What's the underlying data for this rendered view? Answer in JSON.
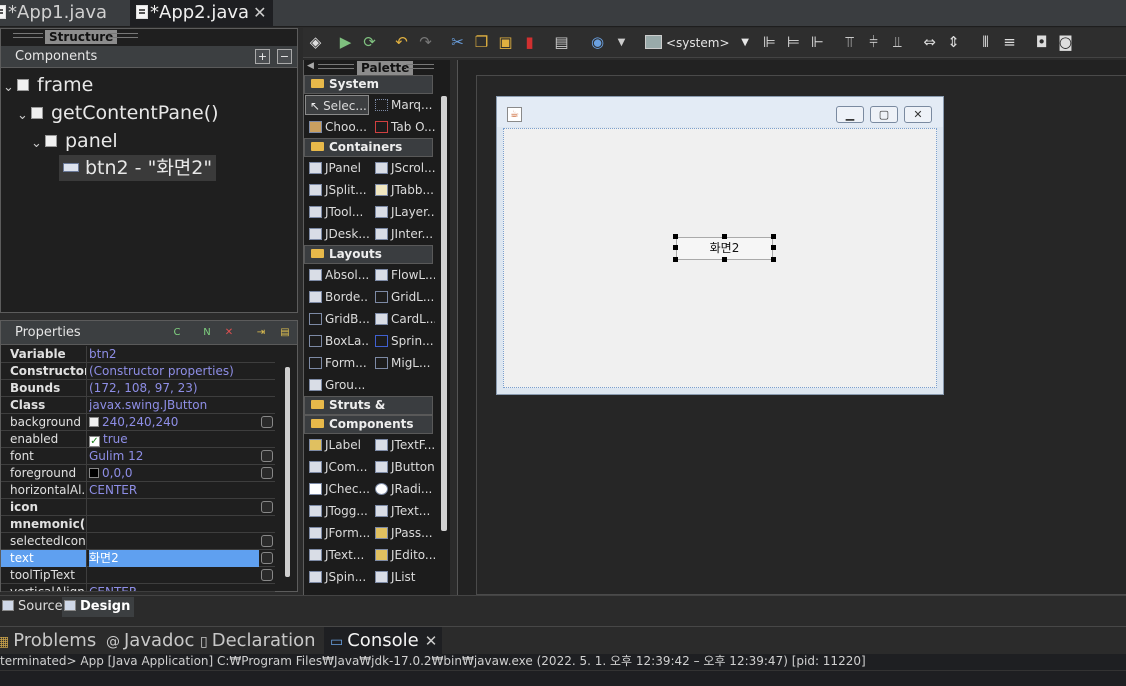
{
  "editor_tabs": [
    {
      "label": "*App1.java"
    },
    {
      "label": "*App2.java"
    }
  ],
  "structure": {
    "title": "Structure",
    "components_label": "Components",
    "tree": [
      {
        "label": "frame"
      },
      {
        "label": "getContentPane()"
      },
      {
        "label": "panel"
      },
      {
        "label": "btn2 - \"화면2\""
      }
    ]
  },
  "properties": {
    "title": "Properties",
    "rows": [
      {
        "name": "Variable",
        "value": "btn2"
      },
      {
        "name": "Constructor",
        "value": "(Constructor properties)"
      },
      {
        "name": "Bounds",
        "value": "(172, 108, 97, 23)"
      },
      {
        "name": "Class",
        "value": "javax.swing.JButton"
      },
      {
        "name": "background",
        "value": "240,240,240"
      },
      {
        "name": "enabled",
        "value": "true"
      },
      {
        "name": "font",
        "value": "Gulim 12"
      },
      {
        "name": "foreground",
        "value": "0,0,0"
      },
      {
        "name": "horizontalAl...",
        "value": "CENTER"
      },
      {
        "name": "icon",
        "value": ""
      },
      {
        "name": "mnemonic(...",
        "value": ""
      },
      {
        "name": "selectedIcon",
        "value": ""
      },
      {
        "name": "text",
        "value": "화면2"
      },
      {
        "name": "toolTipText",
        "value": ""
      },
      {
        "name": "verticalAlign...",
        "value": "CENTER"
      }
    ]
  },
  "palette": {
    "title": "Palette",
    "categories": {
      "system": "System",
      "containers": "Containers",
      "layouts": "Layouts",
      "struts": "Struts & Springs",
      "components": "Components"
    },
    "system_items": [
      "Selec...",
      "Marq...",
      "Choo...",
      "Tab O..."
    ],
    "container_items": [
      "JPanel",
      "JScrol...",
      "JSplit...",
      "JTabb...",
      "JTool...",
      "JLayer...",
      "JDesk...",
      "JInter..."
    ],
    "layout_items": [
      "Absol...",
      "FlowL...",
      "Borde...",
      "GridL...",
      "GridB...",
      "CardL...",
      "BoxLa...",
      "Sprin...",
      "Form...",
      "MigL...",
      "Grou..."
    ],
    "component_items": [
      "JLabel",
      "JTextF...",
      "JCom...",
      "JButton",
      "JChec...",
      "JRadi...",
      "JTogg...",
      "JText...",
      "JForm...",
      "JPass...",
      "JText...",
      "JEdito...",
      "JSpin...",
      "JList"
    ]
  },
  "toolbar": {
    "laf_combo": "<system>"
  },
  "design": {
    "button_text": "화면2"
  },
  "design_tabs": {
    "source": "Source",
    "design": "Design"
  },
  "bottom_tabs": [
    {
      "label": "Problems"
    },
    {
      "label": "Javadoc"
    },
    {
      "label": "Declaration"
    },
    {
      "label": "Console"
    }
  ],
  "console": {
    "status": "terminated> App [Java Application] C:₩Program Files₩Java₩jdk-17.0.2₩bin₩javaw.exe  (2022. 5. 1. 오후 12:39:42 – 오후 12:39:47) [pid: 11220]"
  },
  "colors": {
    "background": "#2b2b2b",
    "selection": "#5fa0f0",
    "property_value": "#8e8ee6"
  }
}
